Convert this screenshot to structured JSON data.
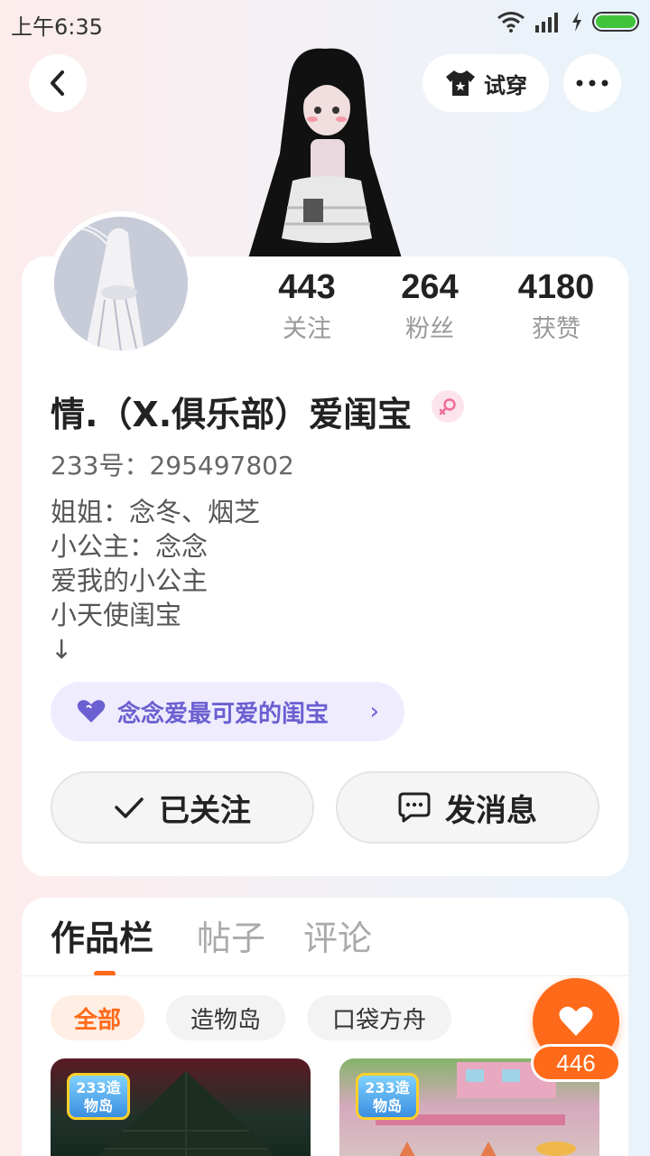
{
  "status_bar": {
    "time": "上午6:35"
  },
  "header": {
    "try_on_label": "试穿"
  },
  "stats": [
    {
      "value": "443",
      "label": "关注"
    },
    {
      "value": "264",
      "label": "粉丝"
    },
    {
      "value": "4180",
      "label": "获赞"
    }
  ],
  "profile": {
    "nickname": "情.（X.俱乐部）爱闺宝",
    "uid": "233号：295497802",
    "bio": [
      "姐姐：念冬、烟芝",
      "小公主：念念",
      "爱我的小公主",
      "小天使闺宝",
      "↓"
    ],
    "tag": "念念爱最可爱的闺宝"
  },
  "actions": {
    "follow_label": "已关注",
    "message_label": "发消息"
  },
  "tabs": [
    {
      "label": "作品栏"
    },
    {
      "label": "帖子"
    },
    {
      "label": "评论"
    }
  ],
  "filters": [
    {
      "label": "全部"
    },
    {
      "label": "造物岛"
    },
    {
      "label": "口袋方舟"
    }
  ],
  "works": [
    {
      "logo_text": "233造物岛"
    },
    {
      "logo_text": "233造物岛"
    }
  ],
  "like_fab": {
    "count": "446"
  },
  "colors": {
    "accent": "#ff6a1a",
    "tag_text": "#6b5fd1",
    "tag_bg": "#eeecfd"
  }
}
